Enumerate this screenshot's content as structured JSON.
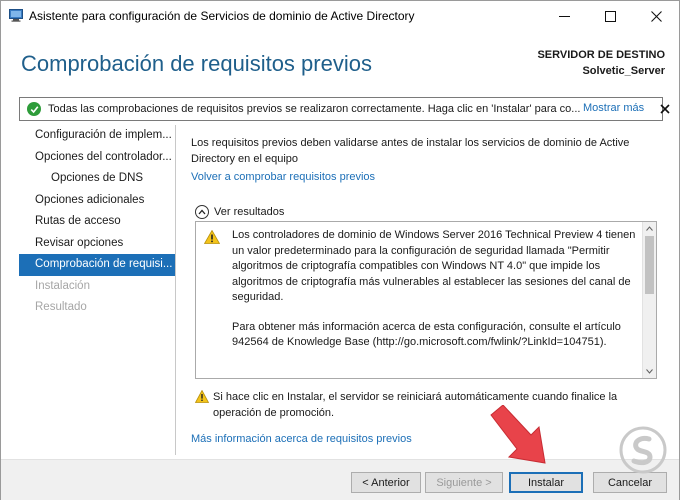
{
  "window": {
    "title": "Asistente para configuración de Servicios de dominio de Active Directory"
  },
  "header": {
    "page_title": "Comprobación de requisitos previos",
    "dest_label": "SERVIDOR DE DESTINO",
    "dest_server": "Solvetic_Server"
  },
  "banner": {
    "message": "Todas las comprobaciones de requisitos previos se realizaron correctamente. Haga clic en 'Instalar' para co...",
    "more_link": "Mostrar más",
    "status_color": "#2e9c3a"
  },
  "sidebar": {
    "items": [
      {
        "label": "Configuración de implem..."
      },
      {
        "label": "Opciones del controlador..."
      },
      {
        "label": "Opciones de DNS"
      },
      {
        "label": "Opciones adicionales"
      },
      {
        "label": "Rutas de acceso"
      },
      {
        "label": "Revisar opciones"
      },
      {
        "label": "Comprobación de requisi..."
      },
      {
        "label": "Instalación"
      },
      {
        "label": "Resultado"
      }
    ],
    "active_index": 6,
    "accent": "#1c6fb7"
  },
  "main": {
    "intro": "Los requisitos previos deben validarse antes de instalar los servicios de dominio de Active Directory en el equipo",
    "recheck_link": "Volver a comprobar requisitos previos",
    "results_toggle": "Ver resultados",
    "results": {
      "paragraph1": "Los controladores de dominio de Windows Server 2016 Technical Preview 4 tienen un valor predeterminado para la configuración de seguridad llamada \"Permitir algoritmos de criptografía compatibles con Windows NT 4.0\" que impide los algoritmos de criptografía más vulnerables al establecer las sesiones del canal de seguridad.",
      "paragraph2": "Para obtener más información acerca de esta configuración, consulte el artículo 942564 de Knowledge Base (http://go.microsoft.com/fwlink/?LinkId=104751)."
    },
    "restart_warning": "Si hace clic en Instalar, el servidor se reiniciará automáticamente cuando finalice la operación de promoción.",
    "more_info_link": "Más información acerca de requisitos previos"
  },
  "footer": {
    "prev_label": "< Anterior",
    "next_label": "Siguiente >",
    "install_label": "Instalar",
    "cancel_label": "Cancelar"
  },
  "icons": {
    "app": "server-manager-icon",
    "success": "check-circle-icon",
    "warning": "warning-icon",
    "close": "close-icon",
    "collapse": "chevron-up-icon"
  }
}
